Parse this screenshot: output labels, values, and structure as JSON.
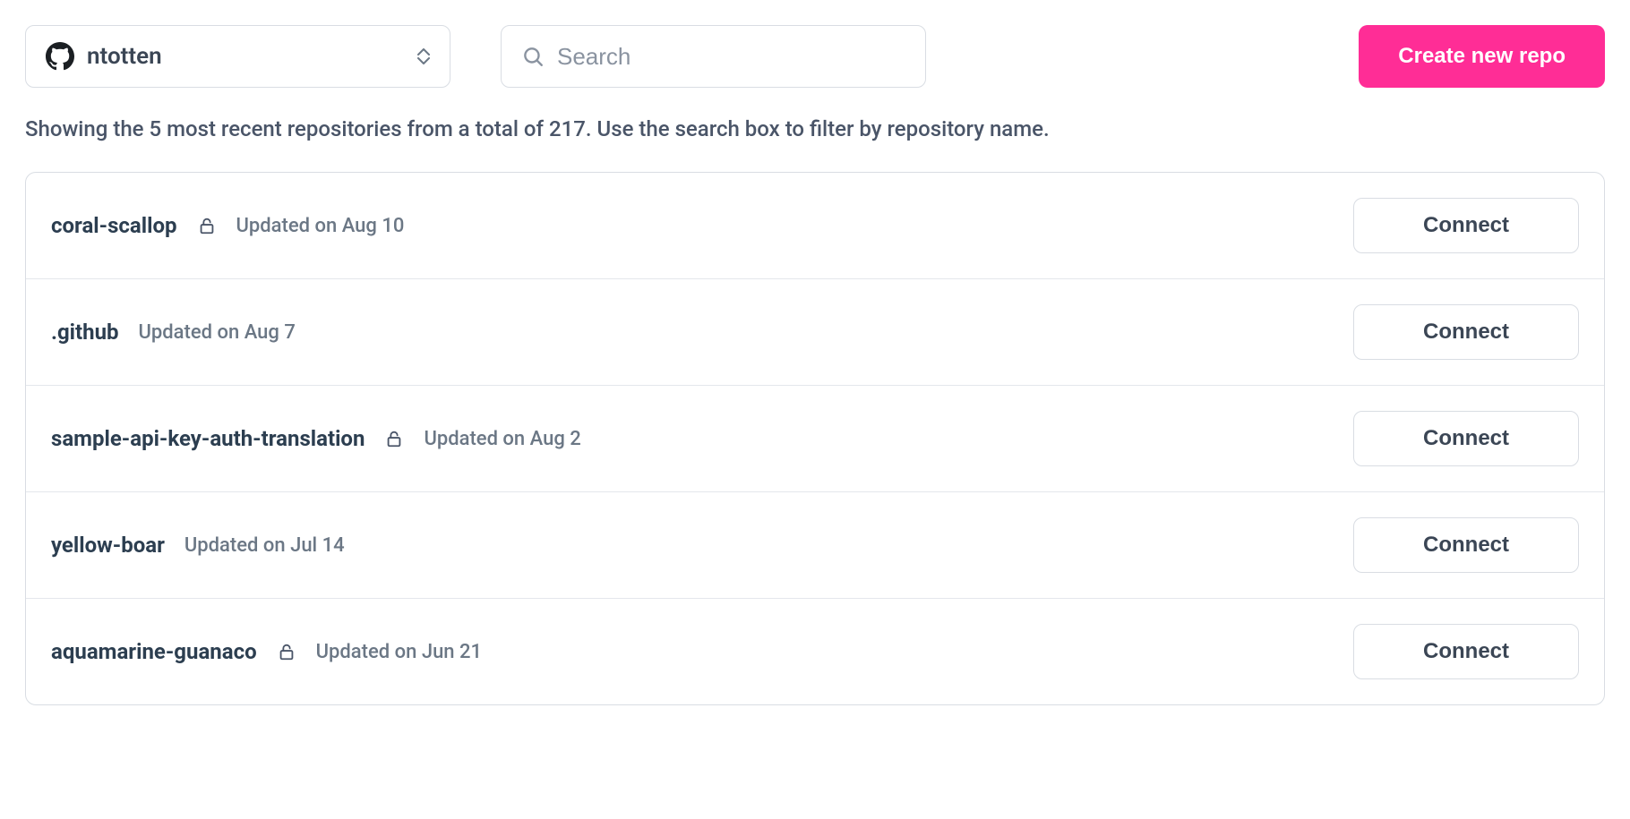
{
  "toolbar": {
    "account": "ntotten",
    "searchPlaceholder": "Search",
    "searchValue": "",
    "createLabel": "Create new repo"
  },
  "summary": "Showing the 5 most recent repositories from a total of 217. Use the search box to filter by repository name.",
  "connectLabel": "Connect",
  "repos": [
    {
      "name": "coral-scallop",
      "private": true,
      "updated": "Updated on Aug 10"
    },
    {
      "name": ".github",
      "private": false,
      "updated": "Updated on Aug 7"
    },
    {
      "name": "sample-api-key-auth-translation",
      "private": true,
      "updated": "Updated on Aug 2"
    },
    {
      "name": "yellow-boar",
      "private": false,
      "updated": "Updated on Jul 14"
    },
    {
      "name": "aquamarine-guanaco",
      "private": true,
      "updated": "Updated on Jun 21"
    }
  ]
}
